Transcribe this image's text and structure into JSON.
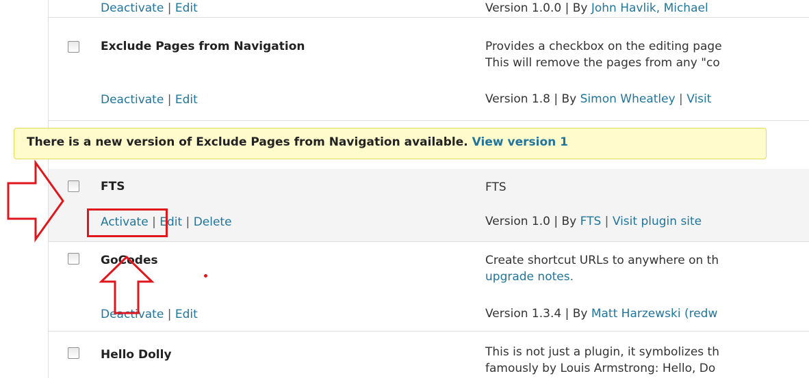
{
  "rows": [
    {
      "actions": {
        "deactivate": "Deactivate",
        "sep": " | ",
        "edit": "Edit"
      },
      "version_text": "Version 1.0.0 | By ",
      "author": "John Havlik, Michael"
    },
    {
      "name": "Exclude Pages from Navigation",
      "desc_line1": "Provides a checkbox on the editing page",
      "desc_line2": "This will remove the pages from any \"co",
      "actions": {
        "deactivate": "Deactivate",
        "sep": " | ",
        "edit": "Edit"
      },
      "version_text": "Version 1.8 | By ",
      "author": "Simon Wheatley",
      "visit": "Visit"
    },
    {
      "name": "FTS",
      "desc_line1": "FTS",
      "actions": {
        "activate": "Activate",
        "sep1": " | ",
        "edit": "Edit",
        "sep2": " | ",
        "delete": "Delete"
      },
      "version_text": "Version 1.0 | By ",
      "author": "FTS",
      "visit": "Visit plugin site"
    },
    {
      "name": "GoCodes",
      "desc_line1": "Create shortcut URLs to anywhere on th",
      "desc_link": "upgrade notes.",
      "actions": {
        "deactivate": "Deactivate",
        "sep": " | ",
        "edit": "Edit"
      },
      "version_text": "Version 1.3.4 | By ",
      "author": "Matt Harzewski (redw"
    },
    {
      "name": "Hello Dolly",
      "desc_line1": "This is not just a plugin, it symbolizes th",
      "desc_line2": "famously by Louis Armstrong: Hello, Do"
    }
  ],
  "notice": {
    "text": "There is a new version of Exclude Pages from Navigation available. ",
    "link": "View version 1"
  },
  "colors": {
    "link": "#21759b",
    "notice_bg": "#fffbcc",
    "annotation_red": "#e0161d"
  }
}
